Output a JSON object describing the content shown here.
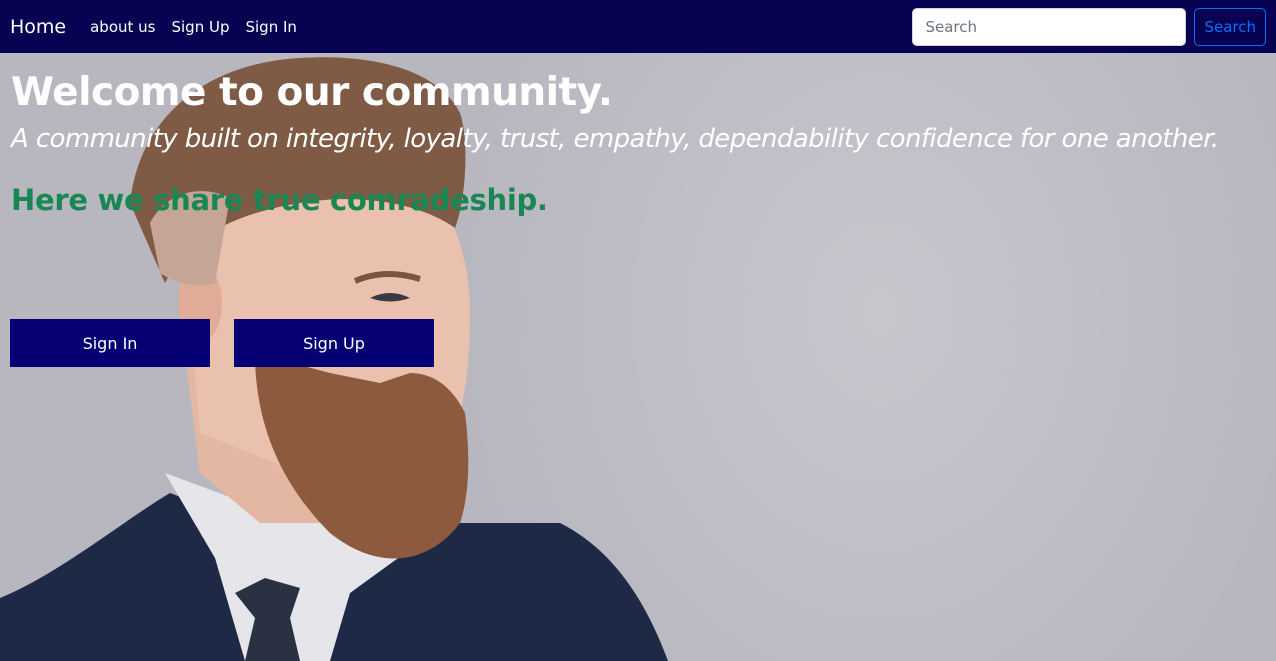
{
  "nav": {
    "brand": "Home",
    "links": [
      "about us",
      "Sign Up",
      "Sign In"
    ],
    "search": {
      "placeholder": "Search",
      "button_label": "Search"
    }
  },
  "hero": {
    "title": "Welcome to our community.",
    "subtitle": "A community built on integrity, loyalty, trust, empathy, dependability confidence for one another.",
    "tagline": "Here we share true comradeship.",
    "buttons": {
      "sign_in": "Sign In",
      "sign_up": "Sign Up"
    }
  },
  "colors": {
    "navbar": "#070352",
    "cta": "#060075",
    "tagline": "#198754",
    "search_outline": "#0d6efd"
  }
}
